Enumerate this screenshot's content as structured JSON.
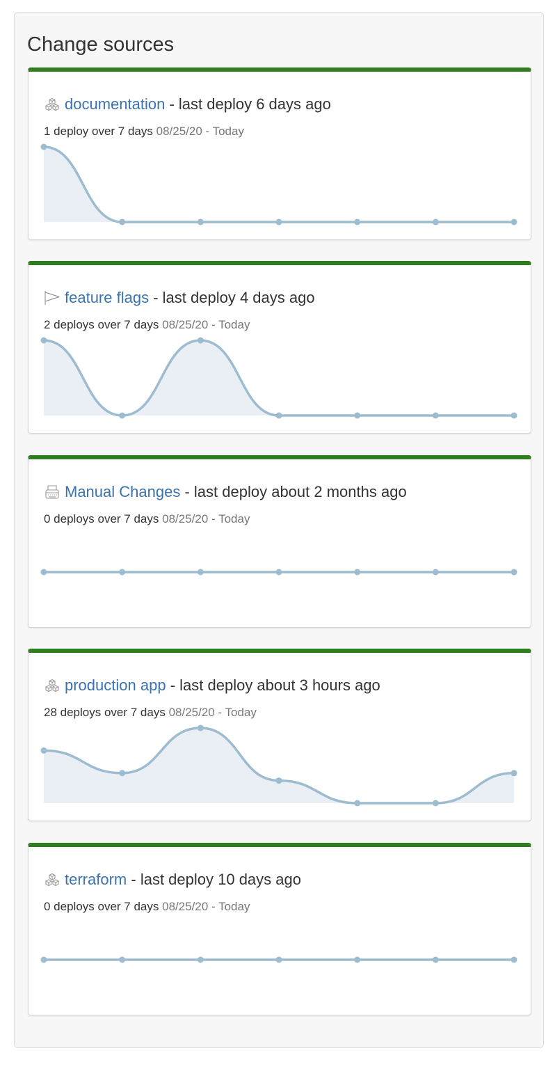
{
  "panel": {
    "title": "Change sources"
  },
  "colors": {
    "accent_bar": "#2e7d1f",
    "link": "#3a73ad",
    "sparkline_line": "#9dbccf",
    "sparkline_fill": "#e9eff4"
  },
  "days_in_range": 7,
  "sources": [
    {
      "icon": "cubes-icon",
      "name": "documentation",
      "separator": "-",
      "last_deploy": "last deploy 6 days ago",
      "deploy_count": "1 deploy over 7 days",
      "date_range": "08/25/20 - Today",
      "daily_deploys": [
        1,
        0,
        0,
        0,
        0,
        0,
        0
      ]
    },
    {
      "icon": "flag-icon",
      "name": "feature flags",
      "separator": "-",
      "last_deploy": "last deploy 4 days ago",
      "deploy_count": "2 deploys over 7 days",
      "date_range": "08/25/20 - Today",
      "daily_deploys": [
        1,
        0,
        1,
        0,
        0,
        0,
        0
      ]
    },
    {
      "icon": "keyboard-icon",
      "name": "Manual Changes",
      "separator": "-",
      "last_deploy": "last deploy about 2 months ago",
      "deploy_count": "0 deploys over 7 days",
      "date_range": "08/25/20 - Today",
      "daily_deploys": [
        0,
        0,
        0,
        0,
        0,
        0,
        0
      ]
    },
    {
      "icon": "cubes-icon",
      "name": "production app",
      "separator": "-",
      "last_deploy": "last deploy about 3 hours ago",
      "deploy_count": "28 deploys over 7 days",
      "date_range": "08/25/20 - Today",
      "daily_deploys": [
        7,
        4,
        10,
        3,
        0,
        0,
        4
      ]
    },
    {
      "icon": "cubes-icon",
      "name": "terraform",
      "separator": "-",
      "last_deploy": "last deploy 10 days ago",
      "deploy_count": "0 deploys over 7 days",
      "date_range": "08/25/20 - Today",
      "daily_deploys": [
        0,
        0,
        0,
        0,
        0,
        0,
        0
      ]
    }
  ]
}
